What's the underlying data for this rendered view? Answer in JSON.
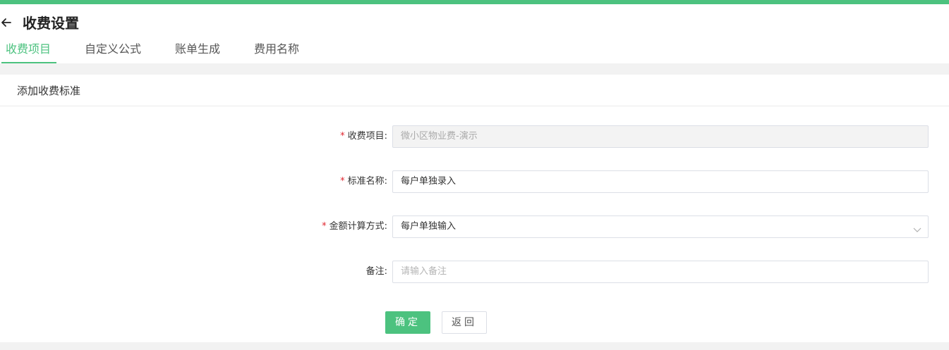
{
  "header": {
    "title": "收费设置"
  },
  "tabs": [
    {
      "label": "收费项目",
      "active": true
    },
    {
      "label": "自定义公式",
      "active": false
    },
    {
      "label": "账单生成",
      "active": false
    },
    {
      "label": "费用名称",
      "active": false
    }
  ],
  "panel": {
    "title": "添加收费标准"
  },
  "form": {
    "required_mark": "*",
    "fields": [
      {
        "label": "收费项目:",
        "required": true,
        "value": "微小区物业费-演示",
        "disabled": true
      },
      {
        "label": "标准名称:",
        "required": true,
        "value": "每户单独录入"
      },
      {
        "label": "金额计算方式:",
        "required": true,
        "value": "每户单独输入",
        "type": "select"
      },
      {
        "label": "备注:",
        "required": false,
        "value": "",
        "placeholder": "请输入备注"
      }
    ]
  },
  "buttons": {
    "confirm": "确定",
    "back": "返回"
  },
  "colors": {
    "accent": "#4cc27f",
    "required": "#e0262f"
  },
  "icons": {
    "back": "arrow-left-icon",
    "select": "chevron-down-icon"
  }
}
